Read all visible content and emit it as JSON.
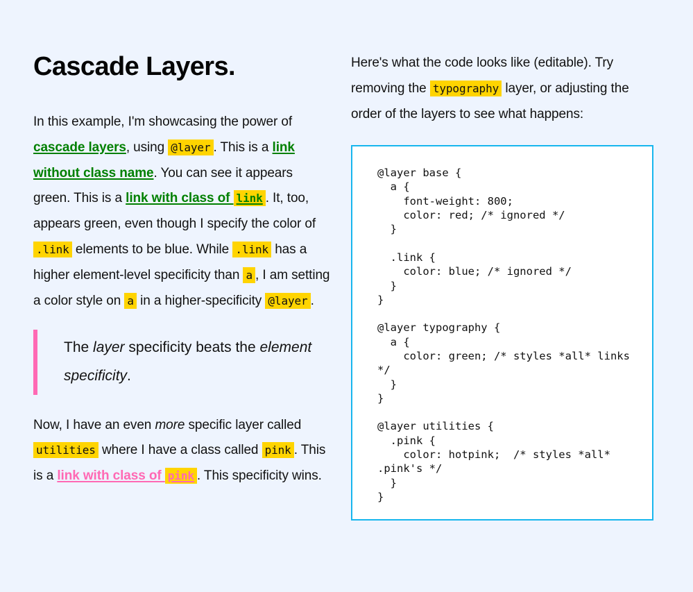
{
  "colors": {
    "page_background": "#eef4fe",
    "highlight": "#ffd400",
    "link_green": "#008000",
    "link_pink": "#ff69b4",
    "quote_border": "#ff69b4",
    "code_border": "#17b6ee",
    "code_background": "#ffffff",
    "text": "#111111"
  },
  "left": {
    "title": "Cascade Layers.",
    "para1": {
      "t1": "In this example, I'm showcasing the power of ",
      "link_cascade_layers": "cascade layers",
      "t2": ", using ",
      "code_atlayer": "@layer",
      "t3": ". This is a ",
      "link_without_class": "link without class name",
      "t4": ". You can see it appears green. This is a ",
      "link_with_class_of": "link with class of ",
      "code_link_class": "link",
      "t5": ". It, too, appears green, even though I specify the color of ",
      "code_dotlink_1": ".link",
      "t6": " elements to be blue. While ",
      "code_dotlink_2": ".link",
      "t7": " has a higher element-level specificity than ",
      "code_a_1": "a",
      "t8": ", I am setting a color style on ",
      "code_a_2": "a",
      "t9": " in a higher-specificity ",
      "code_atlayer_2": "@layer",
      "t10": "."
    },
    "quote": {
      "t1": "The ",
      "em1": "layer",
      "t2": " specificity beats the ",
      "em2": "element specificity",
      "t3": "."
    },
    "para2": {
      "t1": "Now, I have an even ",
      "em1": "more",
      "t2": " specific layer called ",
      "code_utilities": "utilities",
      "t3": " where I have a class called ",
      "code_pink": "pink",
      "t4": ". This is a ",
      "link_with_class_of": "link with class of ",
      "code_pink_link": "pink",
      "t5": ". This specificity wins."
    }
  },
  "right": {
    "intro": {
      "t1": "Here's what the code looks like (editable). Try removing the ",
      "code_typography": "typography",
      "t2": " layer, or adjusting the order of the layers to see what happens:"
    },
    "code": "@layer base {\n  a {\n    font-weight: 800;\n    color: red; /* ignored */\n  }\n\n  .link {\n    color: blue; /* ignored */\n  }\n}\n\n@layer typography {\n  a {\n    color: green; /* styles *all* links */\n  }\n}\n\n@layer utilities {\n  .pink {\n    color: hotpink;  /* styles *all* .pink's */\n  }\n}"
  }
}
